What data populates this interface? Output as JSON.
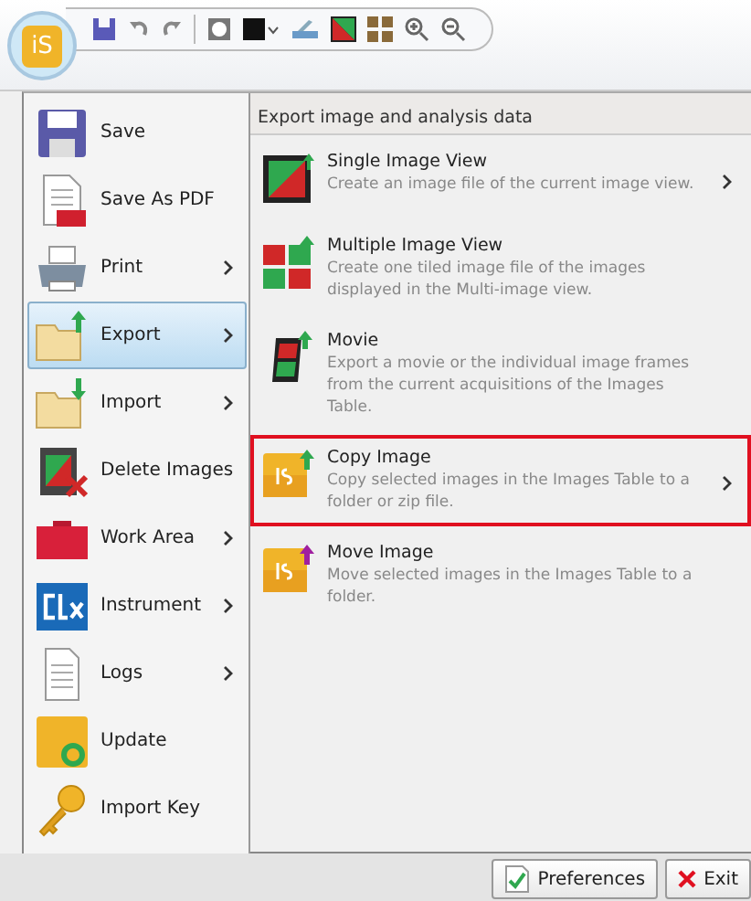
{
  "app_menu": {
    "items": [
      {
        "label": "Save",
        "submenu": false,
        "selected": false
      },
      {
        "label": "Save As PDF",
        "submenu": false,
        "selected": false
      },
      {
        "label": "Print",
        "submenu": true,
        "selected": false
      },
      {
        "label": "Export",
        "submenu": true,
        "selected": true
      },
      {
        "label": "Import",
        "submenu": true,
        "selected": false
      },
      {
        "label": "Delete Images",
        "submenu": false,
        "selected": false
      },
      {
        "label": "Work Area",
        "submenu": true,
        "selected": false
      },
      {
        "label": "Instrument",
        "submenu": true,
        "selected": false
      },
      {
        "label": "Logs",
        "submenu": true,
        "selected": false
      },
      {
        "label": "Update",
        "submenu": false,
        "selected": false
      },
      {
        "label": "Import Key",
        "submenu": false,
        "selected": false
      }
    ]
  },
  "submenu": {
    "header": "Export image and analysis data",
    "items": [
      {
        "title": "Single Image View",
        "description": "Create an image file of the current image view.",
        "submenu": true,
        "highlighted": false
      },
      {
        "title": "Multiple Image View",
        "description": "Create one tiled image file of the images displayed in the Multi-image view.",
        "submenu": false,
        "highlighted": false
      },
      {
        "title": "Movie",
        "description": "Export a movie or the individual image frames from the current acquisitions of the Images Table.",
        "submenu": false,
        "highlighted": false
      },
      {
        "title": "Copy Image",
        "description": "Copy selected images in the Images Table to a folder or zip file.",
        "submenu": true,
        "highlighted": true
      },
      {
        "title": "Move Image",
        "description": "Move selected images in the Images Table to a folder.",
        "submenu": false,
        "highlighted": false
      }
    ]
  },
  "footer": {
    "buttons": [
      {
        "label": "Preferences",
        "kind": "preferences"
      },
      {
        "label": "Exit",
        "kind": "exit"
      }
    ]
  },
  "app_button": {
    "label": "iS"
  }
}
